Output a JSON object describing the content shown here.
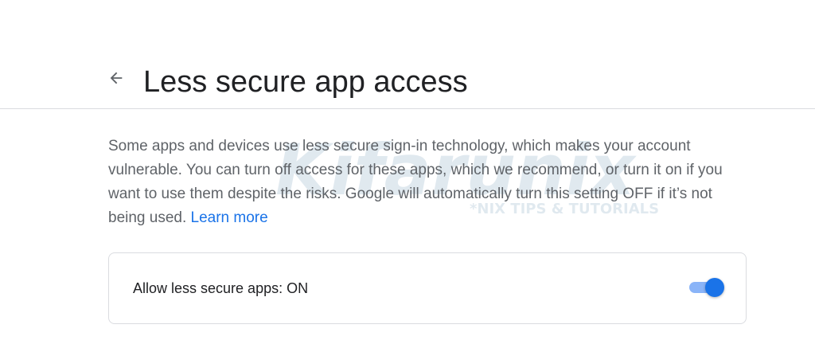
{
  "header": {
    "back_icon": "arrow-back-icon",
    "title": "Less secure app access"
  },
  "main": {
    "description": "Some apps and devices use less secure sign-in technology, which makes your account vulnerable. You can turn off access for these apps, which we recommend, or turn it on if you want to use them despite the risks. Google will automatically turn this setting OFF if it’s not being used.",
    "learn_more_label": "Learn more",
    "setting": {
      "label": "Allow less secure apps: ON",
      "toggle_state": "on"
    }
  },
  "watermark": {
    "logo_text": "Kifarunix",
    "tagline": "*NIX TIPS & TUTORIALS"
  },
  "colors": {
    "title": "#202124",
    "body_text": "#5f6368",
    "link": "#1a73e8",
    "toggle_thumb": "#1a73e8",
    "toggle_track": "#8ab4f8",
    "divider": "#dadce0"
  }
}
